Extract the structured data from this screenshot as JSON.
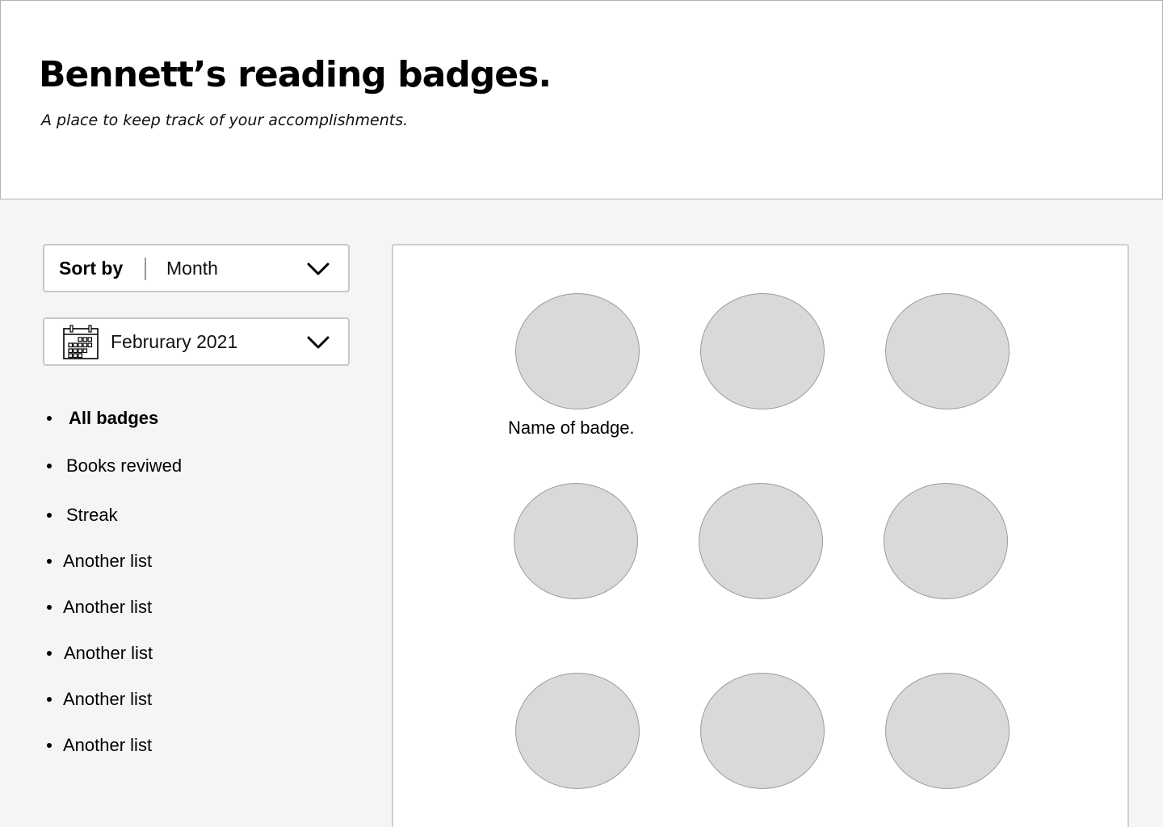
{
  "header": {
    "title": "Bennett’s reading badges.",
    "subtitle": "A place to keep track of your accomplishments."
  },
  "sort": {
    "label": "Sort by",
    "value": "Month",
    "icon": "chevron-down-icon"
  },
  "month_picker": {
    "value": "Februrary 2021",
    "icon": "calendar-icon",
    "chevron_icon": "chevron-down-icon"
  },
  "filters": [
    {
      "label": "All badges",
      "active": true
    },
    {
      "label": "Books reviwed",
      "active": false
    },
    {
      "label": "Streak",
      "active": false
    },
    {
      "label": "Another list",
      "active": false
    },
    {
      "label": "Another list",
      "active": false
    },
    {
      "label": "Another list",
      "active": false
    },
    {
      "label": "Another list",
      "active": false
    },
    {
      "label": "Another list",
      "active": false
    }
  ],
  "badges": {
    "count": 9,
    "first_badge_name": "Name of badge."
  },
  "colors": {
    "page_bg": "#f5f5f5",
    "header_bg": "#ffffff",
    "badge_fill": "#d9d9d9",
    "badge_border": "#9a9a9a",
    "control_border": "#c8c8c8"
  }
}
